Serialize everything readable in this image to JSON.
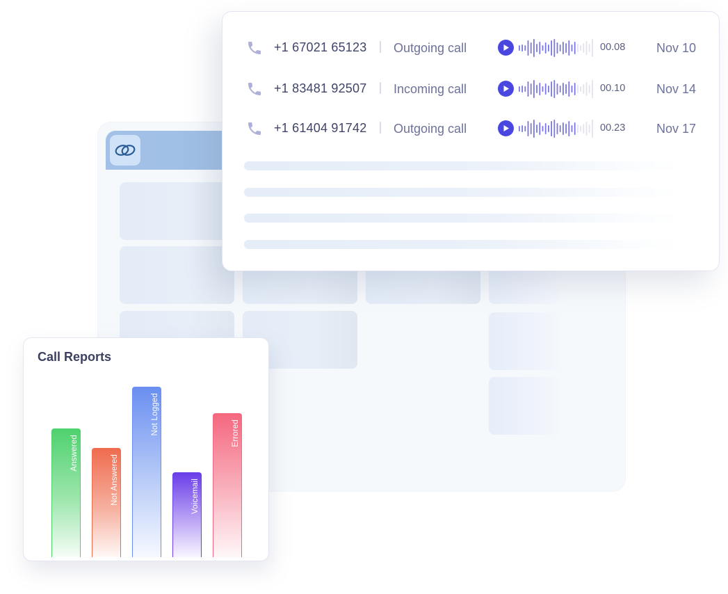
{
  "background_app": {
    "logo_icon": "link-rings-icon"
  },
  "call_log": {
    "calls": [
      {
        "number": "+1 67021 65123",
        "type": "Outgoing call",
        "duration": "00.08",
        "date": "Nov 10"
      },
      {
        "number": "+1 83481 92507",
        "type": "Incoming call",
        "duration": "00.10",
        "date": "Nov 14"
      },
      {
        "number": "+1 61404 91742",
        "type": "Outgoing call",
        "duration": "00.23",
        "date": "Nov 17"
      }
    ],
    "icons": {
      "phone": "phone-icon",
      "play": "play-icon",
      "waveform": "audio-waveform-icon"
    },
    "colors": {
      "accent": "#4a46e0",
      "phone_icon": "#aeb0d8",
      "wave_active": "#7a77e0",
      "wave_inactive": "#e2e2f0"
    }
  },
  "call_reports": {
    "title": "Call Reports",
    "chart_data": {
      "type": "bar",
      "title": "Call Reports",
      "xlabel": "",
      "ylabel": "",
      "categories": [
        "Answered",
        "Not Answered",
        "Not Logged",
        "Voicemail",
        "Errored"
      ],
      "values": [
        74,
        63,
        98,
        49,
        83
      ],
      "ylim": [
        0,
        100
      ],
      "grid": false,
      "legend": "none",
      "colors": [
        "#4fd16f",
        "#ef6c4f",
        "#6a8ff0",
        "#6a3ee8",
        "#f4687f"
      ]
    }
  }
}
